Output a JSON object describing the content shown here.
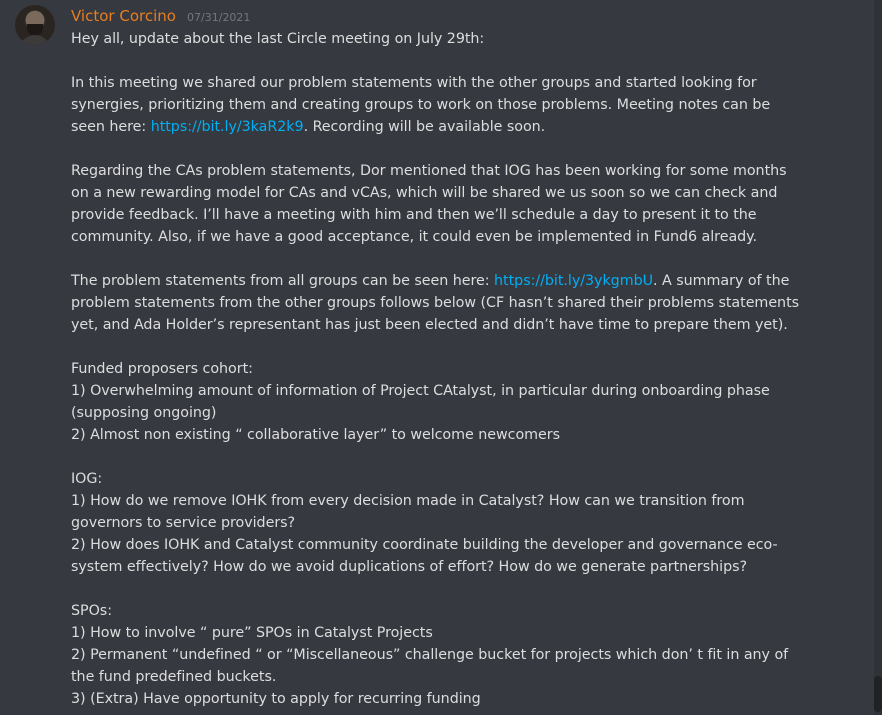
{
  "message": {
    "author": "Victor Corcino",
    "author_color": "#e67e22",
    "timestamp": "07/31/2021",
    "greeting": "Hey all, update about the last Circle meeting on July 29th:",
    "para1_text": "In this meeting we shared our problem statements with the other groups and started looking for synergies, prioritizing them and creating groups to work on those problems. Meeting notes can be seen here: ",
    "para1_link": "https://bit.ly/3kaR2k9",
    "para1_tail": ". Recording will be available soon.",
    "para2": "Regarding the CAs problem statements, Dor mentioned that IOG has been working for some months on a new rewarding model for CAs and vCAs, which will be shared we us soon so we can check and provide feedback. I’ll have a meeting with him and then we’ll schedule a day to present it to the community. Also, if we have a good acceptance, it could even be implemented in Fund6 already.",
    "para3_text": "The problem statements from all groups can be seen here: ",
    "para3_link": "https://bit.ly/3ykgmbU",
    "para3_tail": ". A summary of the problem statements from the other groups follows below (CF hasn’t shared their problems statements yet, and Ada Holder’s representant has just been elected and didn’t have time to prepare them yet).",
    "funded_heading": "Funded proposers cohort:",
    "funded_items": [
      "1) Overwhelming amount of information of Project CAtalyst, in particular during onboarding phase (supposing ongoing)",
      "2) Almost non existing “ collaborative layer” to welcome newcomers"
    ],
    "iog_heading": "IOG:",
    "iog_items": [
      "1) How do we remove IOHK from every decision made in Catalyst? How can we transition from governors to service providers?",
      "2) How does IOHK and Catalyst community coordinate building the developer and governance eco-system effectively? How do we avoid duplications of effort? How do we generate partnerships?"
    ],
    "spo_heading": "SPOs:",
    "spo_items": [
      "1) How to involve “ pure” SPOs in Catalyst Projects",
      "2) Permanent “undefined “ or “Miscellaneous” challenge bucket for projects which don’ t fit in any of the fund predefined buckets.",
      "3) (Extra) Have opportunity to apply for recurring  funding"
    ]
  },
  "colors": {
    "background": "#36393f",
    "text": "#dcddde",
    "link": "#00aff4",
    "timestamp": "#72767d"
  }
}
